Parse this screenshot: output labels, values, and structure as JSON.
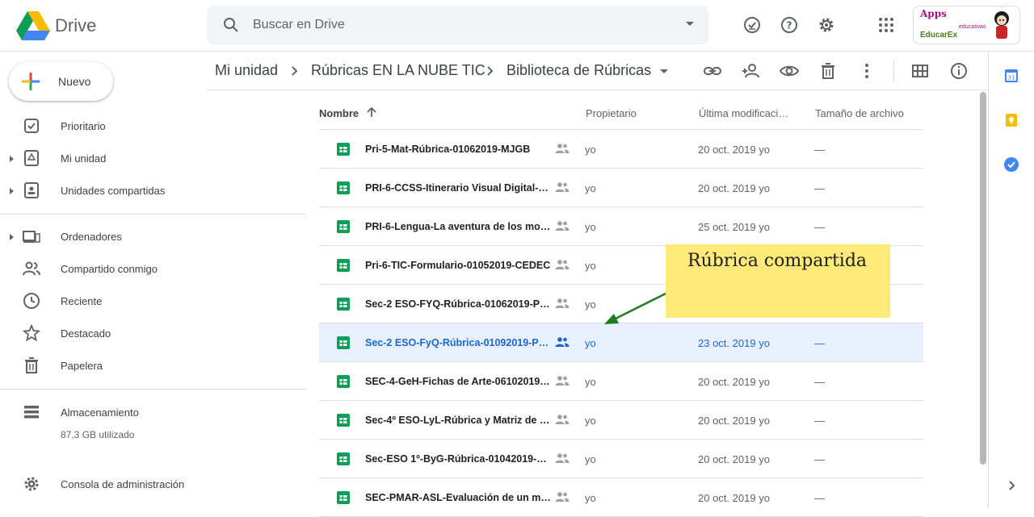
{
  "app": {
    "name": "Drive"
  },
  "search": {
    "placeholder": "Buscar en Drive"
  },
  "account": {
    "logo_text_1": "Apps",
    "logo_text_2": "educativas",
    "logo_text_3": "EducarEx"
  },
  "sidebar": {
    "new_label": "Nuevo",
    "items": [
      {
        "label": "Prioritario",
        "icon": "priority-icon"
      },
      {
        "label": "Mi unidad",
        "icon": "my-drive-icon"
      },
      {
        "label": "Unidades compartidas",
        "icon": "shared-drives-icon"
      },
      {
        "label": "Ordenadores",
        "icon": "computers-icon"
      },
      {
        "label": "Compartido conmigo",
        "icon": "shared-with-me-icon"
      },
      {
        "label": "Reciente",
        "icon": "clock-icon"
      },
      {
        "label": "Destacado",
        "icon": "star-icon"
      },
      {
        "label": "Papelera",
        "icon": "trash-icon"
      },
      {
        "label": "Almacenamiento",
        "icon": "storage-icon"
      },
      {
        "label": "Consola de administración",
        "icon": "admin-console-icon"
      }
    ],
    "storage_used": "87,3 GB utilizado"
  },
  "breadcrumb": [
    "Mi unidad",
    "Rúbricas EN LA NUBE TIC",
    "Biblioteca de Rúbricas"
  ],
  "table": {
    "headers": {
      "name": "Nombre",
      "owner": "Propietario",
      "modified": "Última modificaci…",
      "size": "Tamaño de archivo"
    },
    "rows": [
      {
        "name": "Pri-5-Mat-Rúbrica-01062019-MJGB",
        "owner": "yo",
        "date": "20 oct. 2019",
        "by": "yo",
        "size": "—",
        "selected": false
      },
      {
        "name": "PRI-6-CCSS-Itinerario Visual Digital-0…",
        "owner": "yo",
        "date": "20 oct. 2019",
        "by": "yo",
        "size": "—",
        "selected": false
      },
      {
        "name": "PRI-6-Lengua-La aventura de los moli…",
        "owner": "yo",
        "date": "25 oct. 2019",
        "by": "yo",
        "size": "—",
        "selected": false
      },
      {
        "name": "Pri-6-TIC-Formulario-01052019-CEDEC",
        "owner": "yo",
        "date": "",
        "by": "",
        "size": "",
        "selected": false
      },
      {
        "name": "Sec-2 ESO-FYQ-Rúbrica-01062019-P…",
        "owner": "yo",
        "date": "",
        "by": "",
        "size": "",
        "selected": false
      },
      {
        "name": "Sec-2 ESO-FyQ-Rúbrica-01092019-P…",
        "owner": "yo",
        "date": "23 oct. 2019",
        "by": "yo",
        "size": "—",
        "selected": true
      },
      {
        "name": "SEC-4-GeH-Fichas de Arte-06102019…",
        "owner": "yo",
        "date": "20 oct. 2019",
        "by": "yo",
        "size": "—",
        "selected": false
      },
      {
        "name": "Sec-4º ESO-LyL-Rúbrica y Matriz de C…",
        "owner": "yo",
        "date": "20 oct. 2019",
        "by": "yo",
        "size": "—",
        "selected": false
      },
      {
        "name": "Sec-ESO 1º-ByG-Rúbrica-01042019-…",
        "owner": "yo",
        "date": "20 oct. 2019",
        "by": "yo",
        "size": "—",
        "selected": false
      },
      {
        "name": "SEC-PMAR-ASL-Evaluación de un ma…",
        "owner": "yo",
        "date": "20 oct. 2019",
        "by": "yo",
        "size": "—",
        "selected": false
      }
    ]
  },
  "annotation": {
    "text": "Rúbrica compartida"
  },
  "colors": {
    "accent": "#1a73e8",
    "selected_row": "#e8f0fe",
    "sheets_green": "#0f9d58",
    "callout": "#ffe979",
    "arrow": "#1e7b1e"
  }
}
